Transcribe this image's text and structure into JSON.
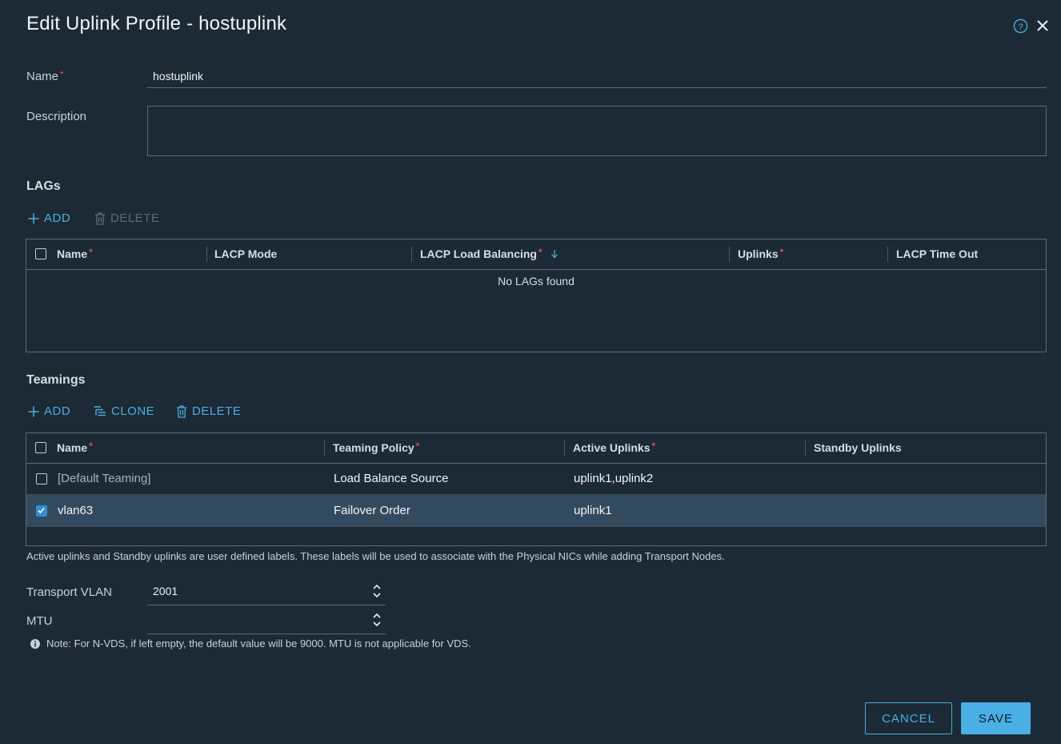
{
  "dialog": {
    "title": "Edit Uplink Profile - hostuplink",
    "help_icon": "help-icon",
    "close_icon": "close-icon"
  },
  "form": {
    "name_label": "Name",
    "name_value": "hostuplink",
    "description_label": "Description",
    "description_value": ""
  },
  "lags": {
    "section_title": "LAGs",
    "add_label": "ADD",
    "delete_label": "DELETE",
    "columns": {
      "name": "Name",
      "lacp_mode": "LACP Mode",
      "lacp_load_balancing": "LACP Load Balancing",
      "uplinks": "Uplinks",
      "lacp_time_out": "LACP Time Out"
    },
    "empty_message": "No LAGs found"
  },
  "teamings": {
    "section_title": "Teamings",
    "add_label": "ADD",
    "clone_label": "CLONE",
    "delete_label": "DELETE",
    "columns": {
      "name": "Name",
      "teaming_policy": "Teaming Policy",
      "active_uplinks": "Active Uplinks",
      "standby_uplinks": "Standby Uplinks"
    },
    "rows": [
      {
        "name": "[Default Teaming]",
        "teaming_policy": "Load Balance Source",
        "active_uplinks": "uplink1,uplink2",
        "standby_uplinks": "",
        "checked": false
      },
      {
        "name": "vlan63",
        "teaming_policy": "Failover Order",
        "active_uplinks": "uplink1",
        "standby_uplinks": "",
        "checked": true
      }
    ],
    "hint": "Active uplinks and Standby uplinks are user defined labels. These labels will be used to associate with the Physical NICs while adding Transport Nodes."
  },
  "transport_vlan": {
    "label": "Transport VLAN",
    "value": "2001"
  },
  "mtu": {
    "label": "MTU",
    "value": "",
    "note": "Note: For N-VDS, if left empty, the default value will be 9000. MTU is not applicable for VDS."
  },
  "footer": {
    "cancel_label": "CANCEL",
    "save_label": "SAVE"
  },
  "colors": {
    "background": "#1b2a35",
    "accent": "#49afe5",
    "required": "#e04c4c",
    "selected_row": "#324a5e"
  }
}
